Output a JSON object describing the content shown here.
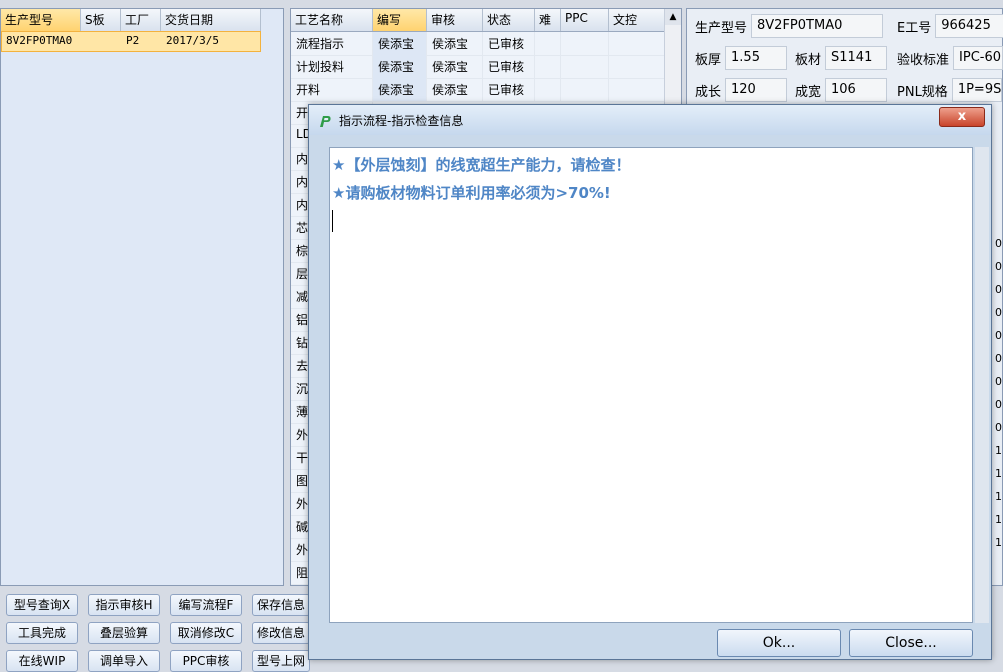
{
  "left_grid": {
    "headers": [
      "生产型号",
      "S板",
      "工厂",
      "交货日期"
    ],
    "row": [
      "8V2FP0TMA0",
      "",
      "P2",
      "2017/3/5"
    ]
  },
  "process_grid": {
    "headers": [
      "工艺名称",
      "编写",
      "审核",
      "状态",
      "难",
      "PPC",
      "文控"
    ],
    "rows": [
      [
        "流程指示",
        "侯添宝",
        "侯添宝",
        "已审核",
        "",
        "",
        ""
      ],
      [
        "计划投料",
        "侯添宝",
        "侯添宝",
        "已审核",
        "",
        "",
        ""
      ],
      [
        "开料",
        "侯添宝",
        "侯添宝",
        "已审核",
        "",
        "",
        ""
      ]
    ],
    "partial_rows": [
      "开",
      "LD",
      "内",
      "内",
      "内",
      "芯",
      "棕",
      "层",
      "减",
      "铝",
      "钻",
      "去",
      "沉",
      "薄",
      "外",
      "干",
      "图",
      "外",
      "碱",
      "外",
      "阻"
    ]
  },
  "info": {
    "product_model_label": "生产型号",
    "product_model": "8V2FP0TMA0",
    "e_no_label": "E工号",
    "e_no": "966425",
    "thickness_label": "板厚",
    "thickness": "1.55",
    "material_label": "板材",
    "material": "S1141",
    "standard_label": "验收标准",
    "standard": "IPC-60",
    "length_label": "成长",
    "length": "120",
    "width_label": "成宽",
    "width": "106",
    "pnl_label": "PNL规格",
    "pnl": "1P=9S"
  },
  "bottom_buttons": {
    "row1": [
      "型号查询X",
      "指示审核H",
      "编写流程F",
      "保存信息"
    ],
    "row2": [
      "工具完成",
      "叠层验算",
      "取消修改C",
      "修改信息"
    ],
    "row3": [
      "在线WIP",
      "调单导入",
      "PPC审核",
      "型号上网"
    ]
  },
  "dialog": {
    "title": "指示流程-指示检查信息",
    "close_label": "x",
    "messages": [
      "★【外层蚀刻】的线宽超生产能力，请检查！",
      "★请购板材物料订单利用率必须为>70%!"
    ],
    "ok_label": "Ok...",
    "close_button_label": "Close..."
  },
  "right_edge_digits": [
    "0",
    "0",
    "0",
    "0",
    "0",
    "0",
    "0",
    "0",
    "0",
    "1",
    "1",
    "1",
    "1",
    "1"
  ],
  "colors": {
    "accent_text": "#4f86c6",
    "selected_row": "#ffe6a6",
    "close_red": "#c9442a"
  }
}
